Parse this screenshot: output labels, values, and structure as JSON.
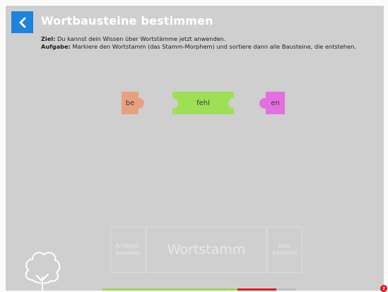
{
  "header": {
    "title": "Wortbausteine bestimmen",
    "back_icon": "chevron-left-icon"
  },
  "instructions": {
    "goal_label": "Ziel:",
    "goal_text": " Du kannst dein Wissen über Wortstämme jetzt anwenden.",
    "task_label": "Aufgabe:",
    "task_text": " Markiere den Wortstamm (das Stamm-Morphem) und sortiere dann alle Bausteine, die entstehen."
  },
  "pieces": [
    {
      "label": "be",
      "color": "#e9a07f"
    },
    {
      "label": "fehl",
      "color": "#9de056"
    },
    {
      "label": "en",
      "color": "#e36fe0"
    }
  ],
  "dropzones": {
    "start": "Anfangs-\nbaustein",
    "stem": "Wortstamm",
    "end": "End-\nbaustein"
  },
  "progress": {
    "green_fraction": 0.7,
    "colors": {
      "done": "#9bd65a",
      "wrong": "#e3131b",
      "track": "#bcbcbc"
    }
  },
  "badge": {
    "count": "2"
  },
  "colors": {
    "accent": "#1e83dd",
    "background": "#cfcfcf"
  }
}
